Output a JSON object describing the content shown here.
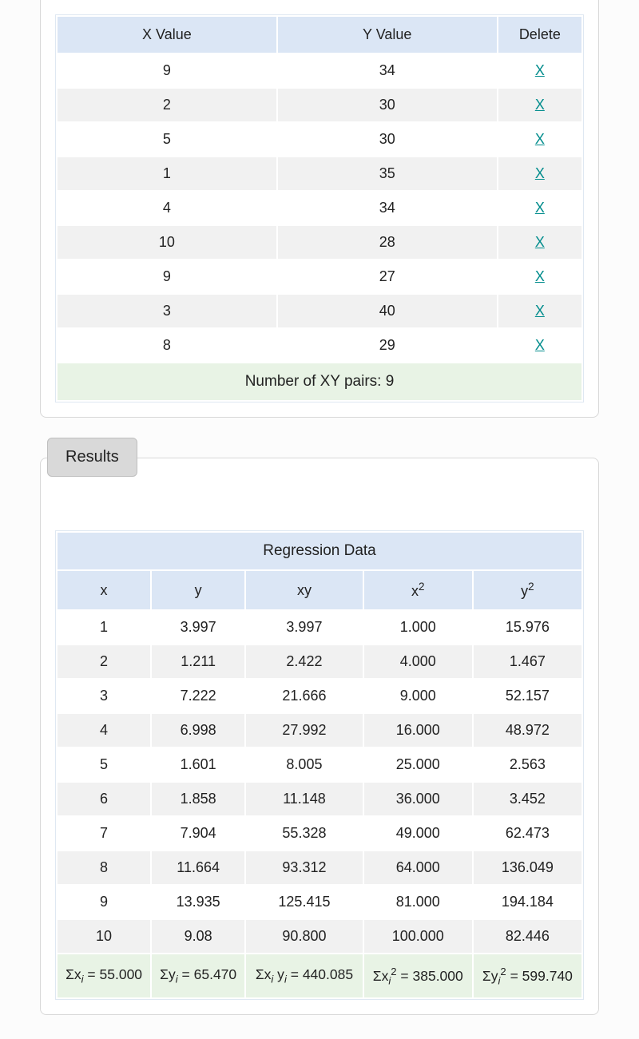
{
  "xy_table": {
    "headers": {
      "x": "X Value",
      "y": "Y Value",
      "del": "Delete"
    },
    "delete_label": "X",
    "rows": [
      {
        "x": "9",
        "y": "34"
      },
      {
        "x": "2",
        "y": "30"
      },
      {
        "x": "5",
        "y": "30"
      },
      {
        "x": "1",
        "y": "35"
      },
      {
        "x": "4",
        "y": "34"
      },
      {
        "x": "10",
        "y": "28"
      },
      {
        "x": "9",
        "y": "27"
      },
      {
        "x": "3",
        "y": "40"
      },
      {
        "x": "8",
        "y": "29"
      }
    ],
    "footer": "Number of XY pairs: 9"
  },
  "results": {
    "tab_label": "Results",
    "title": "Regression Data",
    "headers": {
      "x": "x",
      "y": "y",
      "xy": "xy",
      "x2_base": "x",
      "x2_sup": "2",
      "y2_base": "y",
      "y2_sup": "2"
    },
    "rows": [
      {
        "x": "1",
        "y": "3.997",
        "xy": "3.997",
        "x2": "1.000",
        "y2": "15.976"
      },
      {
        "x": "2",
        "y": "1.211",
        "xy": "2.422",
        "x2": "4.000",
        "y2": "1.467"
      },
      {
        "x": "3",
        "y": "7.222",
        "xy": "21.666",
        "x2": "9.000",
        "y2": "52.157"
      },
      {
        "x": "4",
        "y": "6.998",
        "xy": "27.992",
        "x2": "16.000",
        "y2": "48.972"
      },
      {
        "x": "5",
        "y": "1.601",
        "xy": "8.005",
        "x2": "25.000",
        "y2": "2.563"
      },
      {
        "x": "6",
        "y": "1.858",
        "xy": "11.148",
        "x2": "36.000",
        "y2": "3.452"
      },
      {
        "x": "7",
        "y": "7.904",
        "xy": "55.328",
        "x2": "49.000",
        "y2": "62.473"
      },
      {
        "x": "8",
        "y": "11.664",
        "xy": "93.312",
        "x2": "64.000",
        "y2": "136.049"
      },
      {
        "x": "9",
        "y": "13.935",
        "xy": "125.415",
        "x2": "81.000",
        "y2": "194.184"
      },
      {
        "x": "10",
        "y": "9.08",
        "xy": "90.800",
        "x2": "100.000",
        "y2": "82.446"
      }
    ],
    "sums": {
      "sx": "55.000",
      "sy": "65.470",
      "sxy": "440.085",
      "sx2": "385.000",
      "sy2": "599.740"
    }
  }
}
